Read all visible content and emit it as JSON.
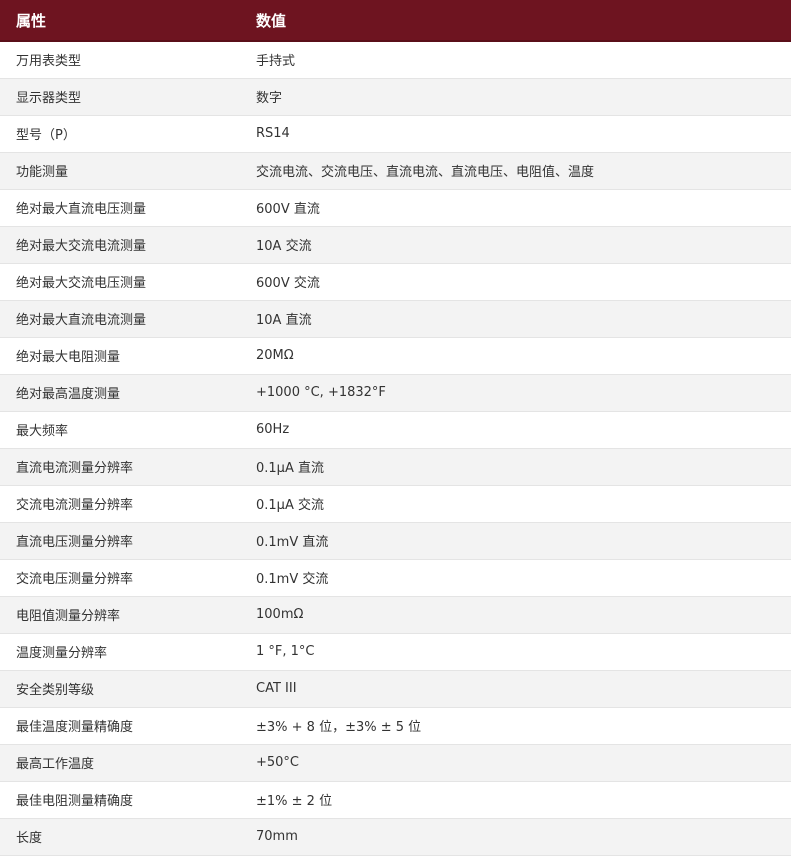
{
  "header": {
    "attribute": "属性",
    "value": "数值"
  },
  "rows": [
    {
      "attribute": "万用表类型",
      "value": "手持式"
    },
    {
      "attribute": "显示器类型",
      "value": "数字"
    },
    {
      "attribute": "型号（P）",
      "value": "RS14"
    },
    {
      "attribute": "功能测量",
      "value": "交流电流、交流电压、直流电流、直流电压、电阻值、温度"
    },
    {
      "attribute": "绝对最大直流电压测量",
      "value": "600V 直流"
    },
    {
      "attribute": "绝对最大交流电流测量",
      "value": "10A 交流"
    },
    {
      "attribute": "绝对最大交流电压测量",
      "value": "600V 交流"
    },
    {
      "attribute": "绝对最大直流电流测量",
      "value": "10A 直流"
    },
    {
      "attribute": "绝对最大电阻测量",
      "value": "20MΩ"
    },
    {
      "attribute": "绝对最高温度测量",
      "value": "+1000 °C, +1832°F"
    },
    {
      "attribute": "最大频率",
      "value": "60Hz"
    },
    {
      "attribute": "直流电流测量分辨率",
      "value": "0.1μA 直流"
    },
    {
      "attribute": "交流电流测量分辨率",
      "value": "0.1μA 交流"
    },
    {
      "attribute": "直流电压测量分辨率",
      "value": "0.1mV 直流"
    },
    {
      "attribute": "交流电压测量分辨率",
      "value": "0.1mV 交流"
    },
    {
      "attribute": "电阻值测量分辨率",
      "value": "100mΩ"
    },
    {
      "attribute": "温度测量分辨率",
      "value": "1 °F, 1°C"
    },
    {
      "attribute": "安全类别等级",
      "value": "CAT III"
    },
    {
      "attribute": "最佳温度测量精确度",
      "value": "±3% + 8 位，±3% ± 5 位"
    },
    {
      "attribute": "最高工作温度",
      "value": "+50°C"
    },
    {
      "attribute": "最佳电阻测量精确度",
      "value": "±1% ± 2 位"
    },
    {
      "attribute": "长度",
      "value": "70mm"
    }
  ]
}
